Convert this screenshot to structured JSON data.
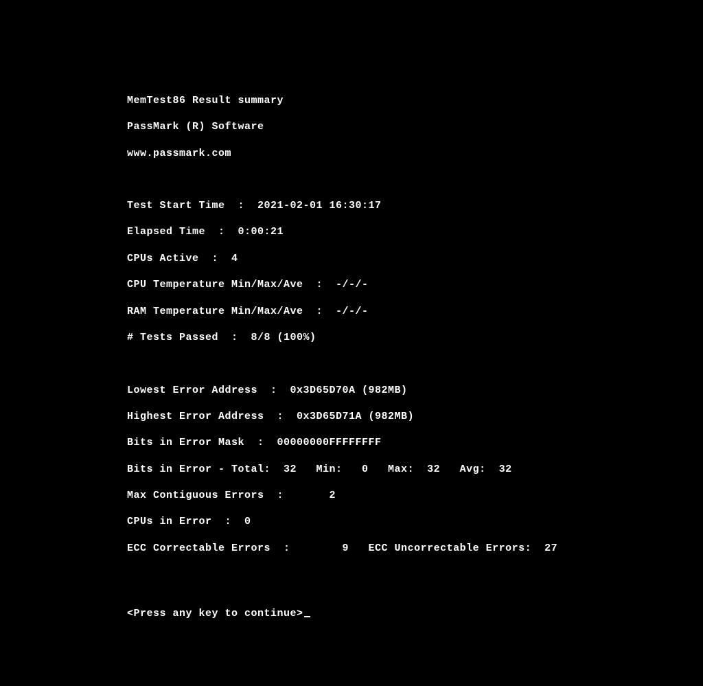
{
  "header": {
    "title": "MemTest86 Result summary",
    "vendor": "PassMark (R) Software",
    "url": "www.passmark.com"
  },
  "timing": {
    "start_line": "Test Start Time  :  2021-02-01 16:30:17",
    "elapsed_line": "Elapsed Time  :  0:00:21",
    "cpus_line": "CPUs Active  :  4",
    "cpu_temp_line": "CPU Temperature Min/Max/Ave  :  -/-/-",
    "ram_temp_line": "RAM Temperature Min/Max/Ave  :  -/-/-",
    "tests_passed_line": "# Tests Passed  :  8/8 (100%)"
  },
  "errors": {
    "lowest_line": "Lowest Error Address  :  0x3D65D70A (982MB)",
    "highest_line": "Highest Error Address  :  0x3D65D71A (982MB)",
    "mask_line": "Bits in Error Mask  :  00000000FFFFFFFF",
    "bits_total_line": "Bits in Error - Total:  32   Min:   0   Max:  32   Avg:  32",
    "contiguous_line": "Max Contiguous Errors  :       2",
    "cpus_err_line": "CPUs in Error  :  0",
    "ecc_line": "ECC Correctable Errors  :        9   ECC Uncorrectable Errors:  27"
  },
  "prompt": "<Press any key to continue>"
}
